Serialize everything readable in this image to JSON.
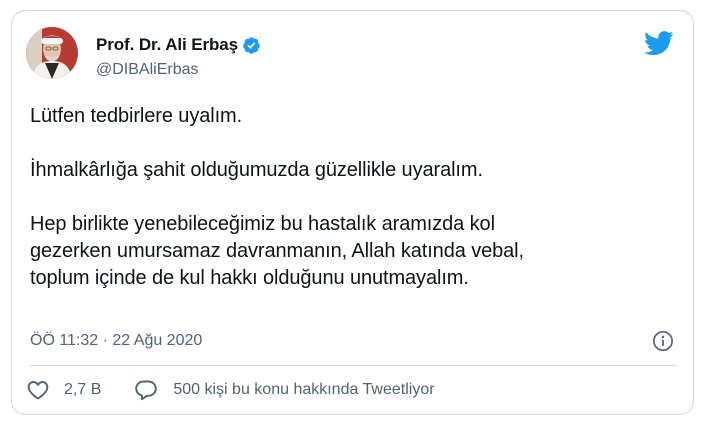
{
  "author": {
    "display_name": "Prof. Dr. Ali Erbaş",
    "handle": "@DIBAliErbas",
    "verified": true
  },
  "tweet": {
    "paragraphs": [
      "Lütfen tedbirlere uyalım.",
      "İhmalkârlığa şahit olduğumuzda güzellikle uyaralım.",
      "Hep birlikte yenebileceğimiz bu hastalık aramızda kol\ngezerken umursamaz davranmanın, Allah katında vebal,\ntoplum içinde de kul hakkı olduğunu unutmayalım."
    ],
    "timestamp": "ÖÖ 11:32 · 22 Ağu 2020"
  },
  "actions": {
    "like_count": "2,7 B",
    "reply_label": "500 kişi bu konu hakkında Tweetliyor"
  },
  "icons": {
    "brand": "twitter-bird-icon",
    "verified": "verified-badge-icon",
    "info": "info-icon",
    "like": "heart-icon",
    "reply": "reply-bubble-icon"
  },
  "colors": {
    "brand_blue": "#1d9bf0",
    "text": "#0f1419",
    "secondary_text": "#536471",
    "border": "#cfd9de"
  }
}
